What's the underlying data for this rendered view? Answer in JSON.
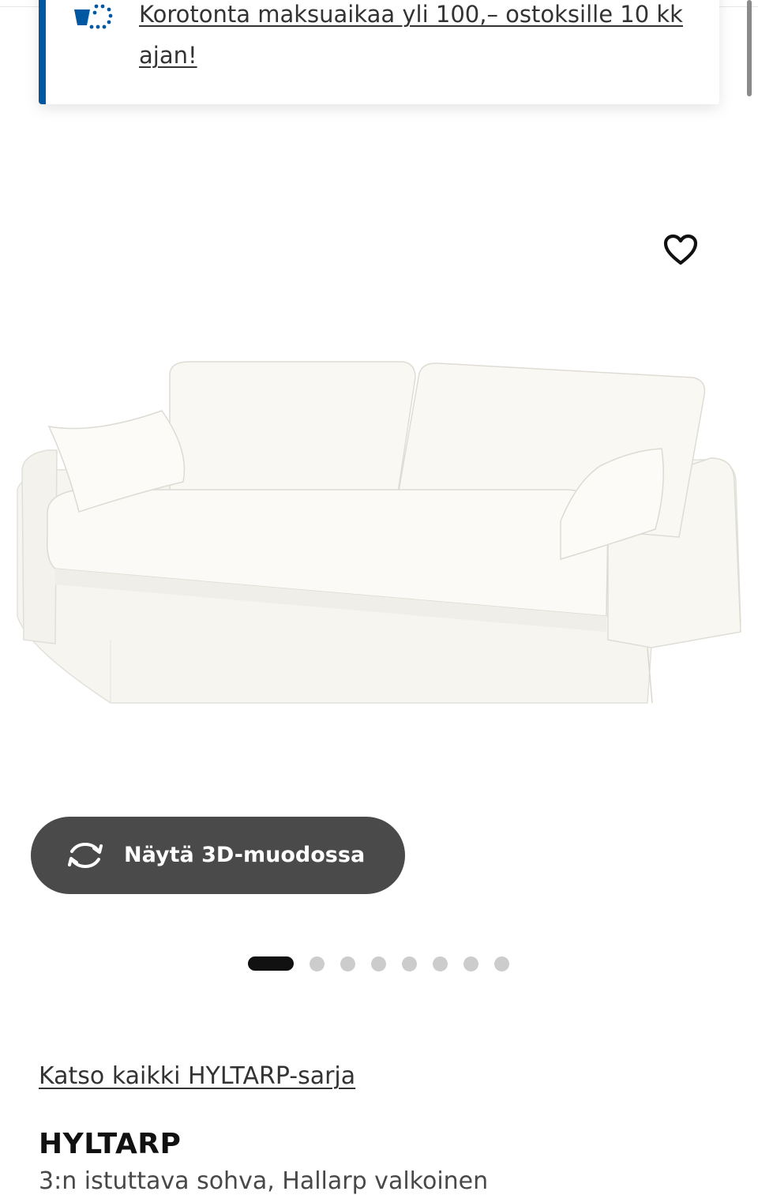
{
  "promo": {
    "icon": "payment-installment-icon",
    "text": "Korotonta maksuaikaa yli 100,– ostoksille 10 kk ajan!",
    "accent_color": "#0058a3"
  },
  "gallery": {
    "favorite_icon": "heart-outline-icon",
    "image_alt": "HYLTARP sohva, valkoinen",
    "view_3d_label": "Näytä 3D-muodossa",
    "view_3d_icon": "rotate-3d-icon",
    "image_count": 8,
    "active_index": 0
  },
  "product": {
    "series_link": "Katso kaikki HYLTARP-sarja",
    "name": "HYLTARP",
    "description": "3:n istuttava sohva, Hallarp valkoinen"
  }
}
